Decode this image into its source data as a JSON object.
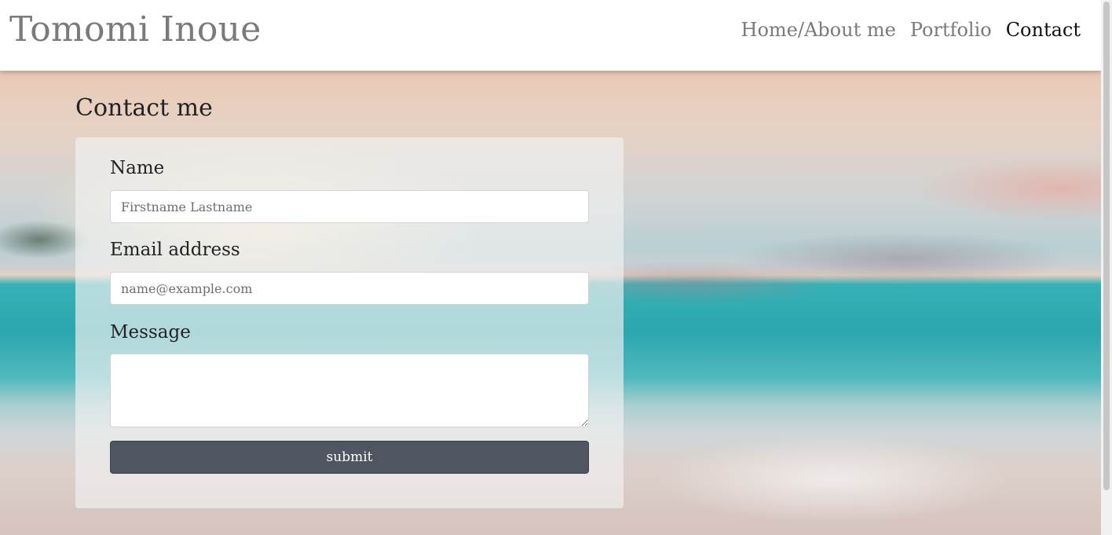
{
  "header": {
    "brand": "Tomomi Inoue",
    "nav": [
      {
        "label": "Home/About me"
      },
      {
        "label": "Portfolio"
      },
      {
        "label": "Contact"
      }
    ]
  },
  "contact": {
    "title": "Contact me",
    "name": {
      "label": "Name",
      "placeholder": "Firstname Lastname",
      "value": ""
    },
    "email": {
      "label": "Email address",
      "placeholder": "name@example.com",
      "value": ""
    },
    "message": {
      "label": "Message",
      "value": ""
    },
    "submit_label": "submit"
  },
  "colors": {
    "accent": "#4f5661",
    "brand_text": "#7a7a7a",
    "nav_active": "#111111"
  },
  "background": {
    "icon": "beach-scene-image"
  }
}
